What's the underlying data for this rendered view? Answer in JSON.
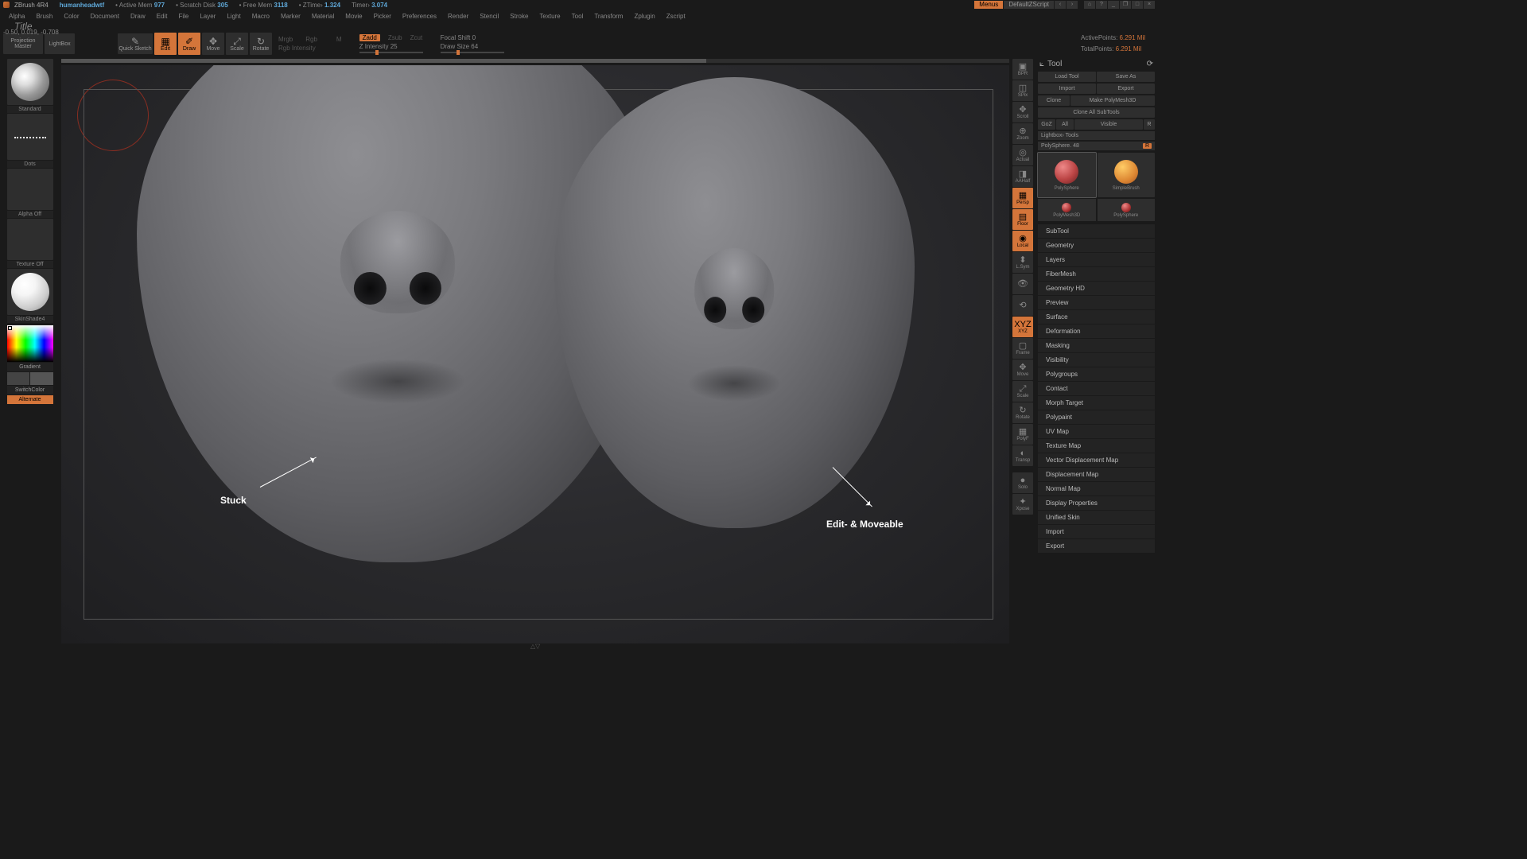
{
  "titlebar": {
    "app": "ZBrush 4R4",
    "doc": "humanheadwtf",
    "mem_label": "Active Mem",
    "mem": "977",
    "scratch_label": "Scratch Disk",
    "scratch": "305",
    "free_label": "Free Mem",
    "free": "3118",
    "ztime_label": "ZTime",
    "ztime": "1.324",
    "timer_label": "Timer",
    "timer": "3.074",
    "menus": "Menus",
    "script": "DefaultZScript"
  },
  "menu": [
    "Alpha",
    "Brush",
    "Color",
    "Document",
    "Draw",
    "Edit",
    "File",
    "Layer",
    "Light",
    "Macro",
    "Marker",
    "Material",
    "Movie",
    "Picker",
    "Preferences",
    "Render",
    "Stencil",
    "Stroke",
    "Texture",
    "Tool",
    "Transform",
    "Zplugin",
    "Zscript"
  ],
  "subtitle": "Title",
  "coords": "-0.50, 0.019, -0.708",
  "toolbar": {
    "projection": "Projection Master",
    "lightbox": "LightBox",
    "quicksketch": "Quick Sketch",
    "edit": "Edit",
    "draw": "Draw",
    "move": "Move",
    "scale": "Scale",
    "rotate": "Rotate",
    "mrgb": "Mrgb",
    "rgb": "Rgb",
    "m": "M",
    "rgb_intensity": "Rgb Intensity",
    "zadd": "Zadd",
    "zsub": "Zsub",
    "zcut": "Zcut",
    "z_intensity": "Z Intensity 25",
    "focal": "Focal Shift 0",
    "drawsize": "Draw Size 64",
    "active_pts_label": "ActivePoints:",
    "active_pts": "6.291 Mil",
    "total_pts_label": "TotalPoints:",
    "total_pts": "6.291 Mil"
  },
  "left": {
    "brush": "Standard",
    "stroke": "Dots",
    "alpha": "Alpha Off",
    "texture": "Texture Off",
    "material": "SkinShade4",
    "gradient": "Gradient",
    "switch": "SwitchColor",
    "alternate": "Alternate"
  },
  "rside": [
    "BPR",
    "SPix",
    "Scroll",
    "Zoom",
    "Actual",
    "AAHalf",
    "Persp",
    "Floor",
    "Local",
    "L.Sym",
    "",
    "",
    "XYZ",
    "Frame",
    "Move",
    "Scale",
    "Rotate",
    "PolyF",
    "Transp",
    "",
    "Solo",
    "Xpose"
  ],
  "rside_active": [
    6,
    7,
    8,
    12
  ],
  "tool": {
    "title": "Tool",
    "load": "Load Tool",
    "saveas": "Save As",
    "import": "Import",
    "export": "Export",
    "clone": "Clone",
    "make_pm3d": "Make PolyMesh3D",
    "clone_all": "Clone All SubTools",
    "goz": "GoZ",
    "all": "All",
    "visible": "Visible",
    "r": "R",
    "lightbox_tools": "Lightbox› Tools",
    "current": "PolySphere. 48",
    "r2": "R",
    "cells": [
      "PolySphere",
      "SimpleBrush",
      "PolyMesh3D",
      "PolySphere"
    ],
    "sections": [
      "SubTool",
      "Geometry",
      "Layers",
      "FiberMesh",
      "Geometry HD",
      "Preview",
      "Surface",
      "Deformation",
      "Masking",
      "Visibility",
      "Polygroups",
      "Contact",
      "Morph Target",
      "Polypaint",
      "UV Map",
      "Texture Map",
      "Vector Displacement Map",
      "Displacement Map",
      "Normal Map",
      "Display Properties",
      "Unified Skin",
      "Import",
      "Export"
    ]
  },
  "annotations": {
    "stuck": "Stuck",
    "editable": "Edit- & Moveable"
  }
}
